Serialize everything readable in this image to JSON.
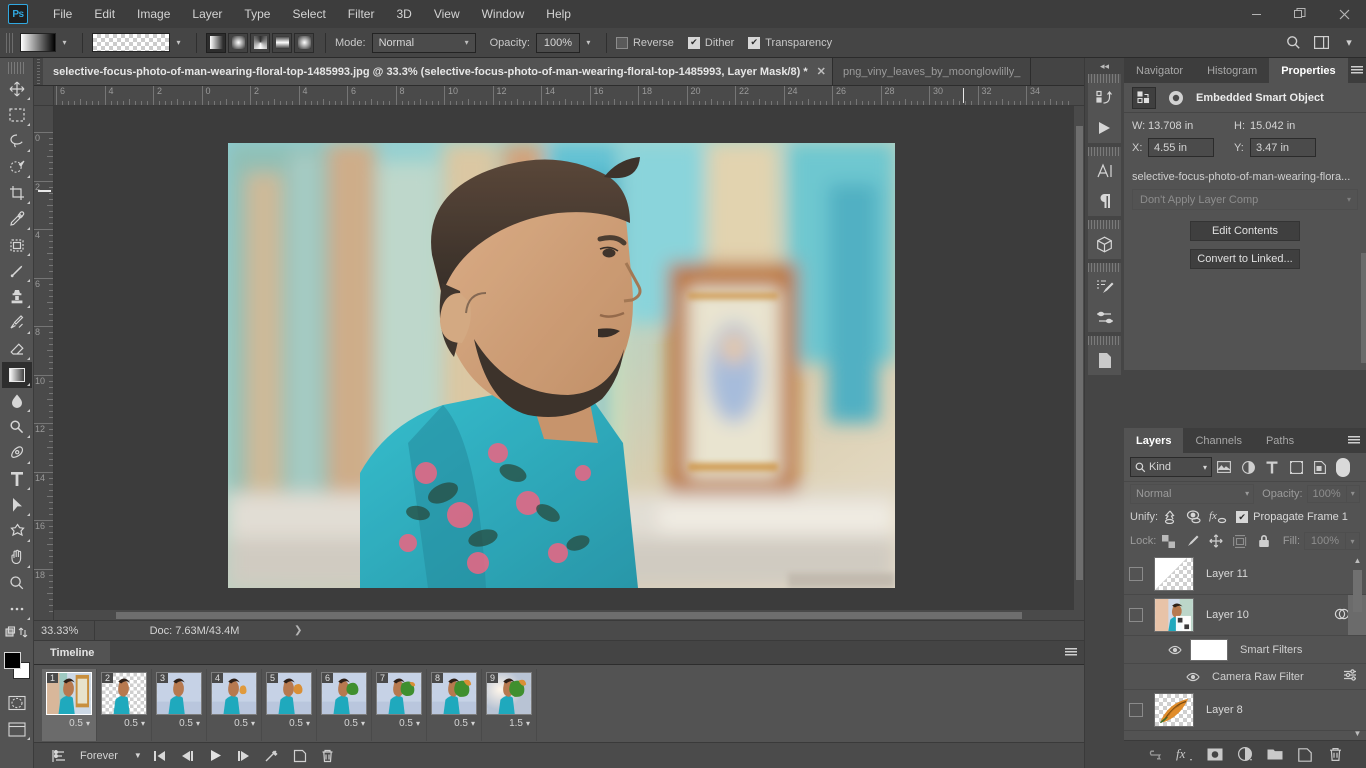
{
  "app": {
    "logo": "Ps",
    "menus": [
      "File",
      "Edit",
      "Image",
      "Layer",
      "Type",
      "Select",
      "Filter",
      "3D",
      "View",
      "Window",
      "Help"
    ],
    "window_buttons": {
      "minimize": "—",
      "maximize": "❐",
      "close": "✕"
    }
  },
  "options_bar": {
    "gradient_swatch_name": "gradient-swatch",
    "gradient_preset_name": "gradient-preset",
    "gradient_types": [
      "linear-gradient",
      "radial-gradient",
      "angle-gradient",
      "reflected-gradient",
      "diamond-gradient"
    ],
    "active_gradient_type": 0,
    "mode_label": "Mode:",
    "mode_value": "Normal",
    "opacity_label": "Opacity:",
    "opacity_value": "100%",
    "checkboxes": [
      {
        "label": "Reverse",
        "checked": false
      },
      {
        "label": "Dither",
        "checked": true
      },
      {
        "label": "Transparency",
        "checked": true
      }
    ],
    "right_icons": [
      "search-icon",
      "workspace-icon",
      "chevron-down-icon"
    ]
  },
  "toolbar": {
    "tools": [
      {
        "name": "move-tool"
      },
      {
        "name": "rectangular-marquee-tool"
      },
      {
        "name": "lasso-tool"
      },
      {
        "name": "object-selection-tool"
      },
      {
        "name": "crop-tool"
      },
      {
        "name": "eyedropper-tool"
      },
      {
        "name": "frame-tool"
      },
      {
        "name": "spot-healing-brush-tool"
      },
      {
        "name": "clone-stamp-tool"
      },
      {
        "name": "history-brush-tool"
      },
      {
        "name": "eraser-tool"
      },
      {
        "name": "gradient-tool"
      },
      {
        "name": "blur-tool"
      },
      {
        "name": "dodge-tool"
      },
      {
        "name": "pen-tool"
      },
      {
        "name": "type-tool"
      },
      {
        "name": "path-selection-tool"
      },
      {
        "name": "custom-shape-tool"
      },
      {
        "name": "hand-tool"
      },
      {
        "name": "zoom-tool"
      },
      {
        "name": "more-tools"
      }
    ],
    "active_tool": 11,
    "foreground_color": "#000000",
    "background_color": "#ffffff"
  },
  "tabs": {
    "active": "selective-focus-photo-of-man-wearing-floral-top-1485993.jpg @ 33.3% (selective-focus-photo-of-man-wearing-floral-top-1485993, Layer Mask/8) *",
    "inactive": "png_viny_leaves_by_moonglowlilly_",
    "close_glyph": "✕",
    "overflow_glyph": "»"
  },
  "rulers": {
    "horizontal_ticks": [
      "6",
      "4",
      "2",
      "0",
      "2",
      "4",
      "6",
      "8",
      "10",
      "12",
      "14",
      "16",
      "18",
      "20",
      "22",
      "24",
      "26",
      "28",
      "30",
      "32",
      "34"
    ],
    "vertical_ticks": [
      "0",
      "2",
      "4",
      "6",
      "8",
      "10",
      "12",
      "14",
      "16",
      "18"
    ],
    "unit": "in"
  },
  "status_bar": {
    "zoom": "33.33%",
    "doc": "Doc: 7.63M/43.4M",
    "arrow": "❯"
  },
  "timeline": {
    "tab_label": "Timeline",
    "menu_icon": "panel-menu-icon",
    "frames": [
      {
        "number": "1",
        "delay": "0.5",
        "selected": true
      },
      {
        "number": "2",
        "delay": "0.5",
        "selected": false
      },
      {
        "number": "3",
        "delay": "0.5",
        "selected": false
      },
      {
        "number": "4",
        "delay": "0.5",
        "selected": false
      },
      {
        "number": "5",
        "delay": "0.5",
        "selected": false
      },
      {
        "number": "6",
        "delay": "0.5",
        "selected": false
      },
      {
        "number": "7",
        "delay": "0.5",
        "selected": false
      },
      {
        "number": "8",
        "delay": "0.5",
        "selected": false
      },
      {
        "number": "9",
        "delay": "1.5",
        "selected": false
      }
    ],
    "loop_value": "Forever",
    "controls": [
      "convert-to-video-timeline-icon",
      "select-first-frame-icon",
      "select-previous-frame-icon",
      "play-animation-icon",
      "select-next-frame-icon",
      "tween-frames-icon",
      "duplicate-frame-icon",
      "delete-frame-icon"
    ]
  },
  "rail": {
    "collapse_glyph": "◂◂",
    "buttons": [
      "actions-icon",
      "play-icon",
      "character-icon",
      "paragraph-icon",
      "3d-icon",
      "brush-settings-icon",
      "brush-presets-icon",
      "adjustments-icon"
    ]
  },
  "properties": {
    "tabs": [
      "Navigator",
      "Histogram",
      "Properties"
    ],
    "active_tab": "Properties",
    "menu_icon": "panel-menu-icon",
    "header_title": "Embedded Smart Object",
    "header_icons": [
      "smart-object-icon",
      "mask-icon"
    ],
    "dims": [
      {
        "key": "W:",
        "value": "13.708 in"
      },
      {
        "key": "H:",
        "value": "15.042 in"
      }
    ],
    "pos": [
      {
        "key": "X:",
        "value": "4.55 in"
      },
      {
        "key": "Y:",
        "value": "3.47 in"
      }
    ],
    "source_name": "selective-focus-photo-of-man-wearing-flora...",
    "layer_comp": "Don't Apply Layer Comp",
    "buttons": [
      "Edit Contents",
      "Convert to Linked..."
    ]
  },
  "layers_panel": {
    "tabs": [
      "Layers",
      "Channels",
      "Paths"
    ],
    "active_tab": "Layers",
    "menu_icon": "panel-menu-icon",
    "filter_kind": "Kind",
    "filter_icons": [
      "filter-pixel-icon",
      "filter-adjustment-icon",
      "filter-type-icon",
      "filter-shape-icon",
      "filter-smartobject-icon"
    ],
    "filter_toggle": "filter-enable-toggle",
    "blend_mode": "Normal",
    "opacity_label": "Opacity:",
    "opacity_value": "100%",
    "unify_label": "Unify:",
    "unify_icons": [
      "unify-position-icon",
      "unify-visibility-icon",
      "unify-style-icon"
    ],
    "propagate_label": "Propagate Frame 1",
    "propagate_checked": true,
    "lock_label": "Lock:",
    "lock_icons": [
      "lock-transparency-icon",
      "lock-image-icon",
      "lock-position-icon",
      "lock-artboard-icon",
      "lock-all-icon"
    ],
    "fill_label": "Fill:",
    "fill_value": "100%",
    "layers": [
      {
        "name": "Layer 11",
        "kind": "empty",
        "visible": false
      },
      {
        "name": "Layer 10",
        "kind": "photo",
        "visible": false,
        "selected": true,
        "children": [
          {
            "name": "Smart Filters",
            "kind": "smart-filters",
            "visible": true
          },
          {
            "name": "Camera Raw Filter",
            "kind": "filter",
            "visible": true
          }
        ]
      },
      {
        "name": "Layer 8",
        "kind": "leaves",
        "visible": false
      }
    ],
    "bottom_icons": [
      "link-layers-icon",
      "layer-style-icon",
      "layer-mask-icon",
      "adjustment-layer-icon",
      "new-group-icon",
      "new-layer-icon",
      "delete-layer-icon"
    ]
  }
}
